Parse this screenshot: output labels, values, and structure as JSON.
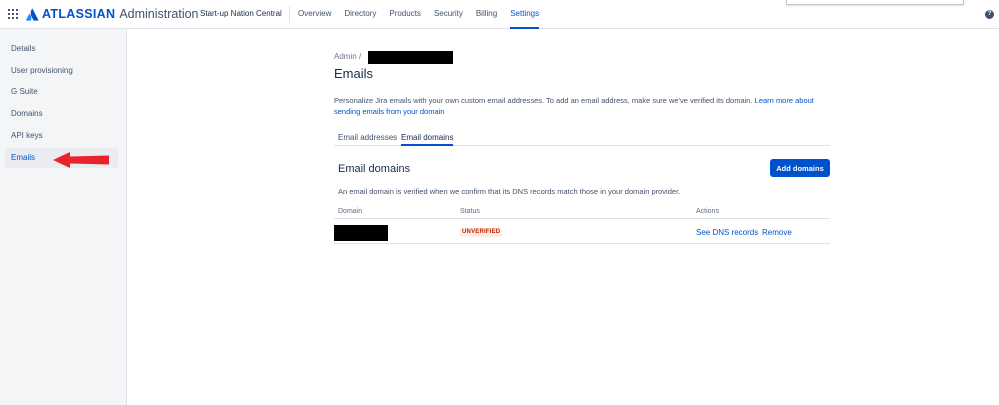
{
  "header": {
    "brand": "ATLASSIAN",
    "product": "Administration",
    "org_name": "Start-up Nation Central",
    "nav": [
      {
        "label": "Overview",
        "active": false
      },
      {
        "label": "Directory",
        "active": false
      },
      {
        "label": "Products",
        "active": false
      },
      {
        "label": "Security",
        "active": false
      },
      {
        "label": "Billing",
        "active": false
      },
      {
        "label": "Settings",
        "active": true
      }
    ],
    "help_glyph": "?"
  },
  "sidebar": {
    "items": [
      {
        "label": "Details",
        "active": false
      },
      {
        "label": "User provisioning",
        "active": false
      },
      {
        "label": "G Suite",
        "active": false
      },
      {
        "label": "Domains",
        "active": false
      },
      {
        "label": "API keys",
        "active": false
      },
      {
        "label": "Emails",
        "active": true
      }
    ]
  },
  "page": {
    "breadcrumb_root": "Admin",
    "breadcrumb_separator": "/",
    "title": "Emails",
    "description": "Personalize Jira emails with your own custom email addresses. To add an email address, make sure we've verified its domain.",
    "learn_more_link": "Learn more about sending emails from your domain",
    "tabs": [
      {
        "label": "Email addresses",
        "active": false
      },
      {
        "label": "Email domains",
        "active": true
      }
    ]
  },
  "email_domains": {
    "title": "Email domains",
    "add_button": "Add domains",
    "description": "An email domain is verified when we confirm that its DNS records match those in your domain provider.",
    "columns": {
      "domain": "Domain",
      "status": "Status",
      "actions": "Actions"
    },
    "rows": [
      {
        "status": "UNVERIFIED",
        "actions": [
          "See DNS records",
          "Remove"
        ]
      }
    ]
  },
  "colors": {
    "brand_blue": "#0052cc",
    "unverified_text": "#bf2600",
    "unverified_bg": "#ffebe6",
    "annotation_arrow": "#e8242a"
  }
}
